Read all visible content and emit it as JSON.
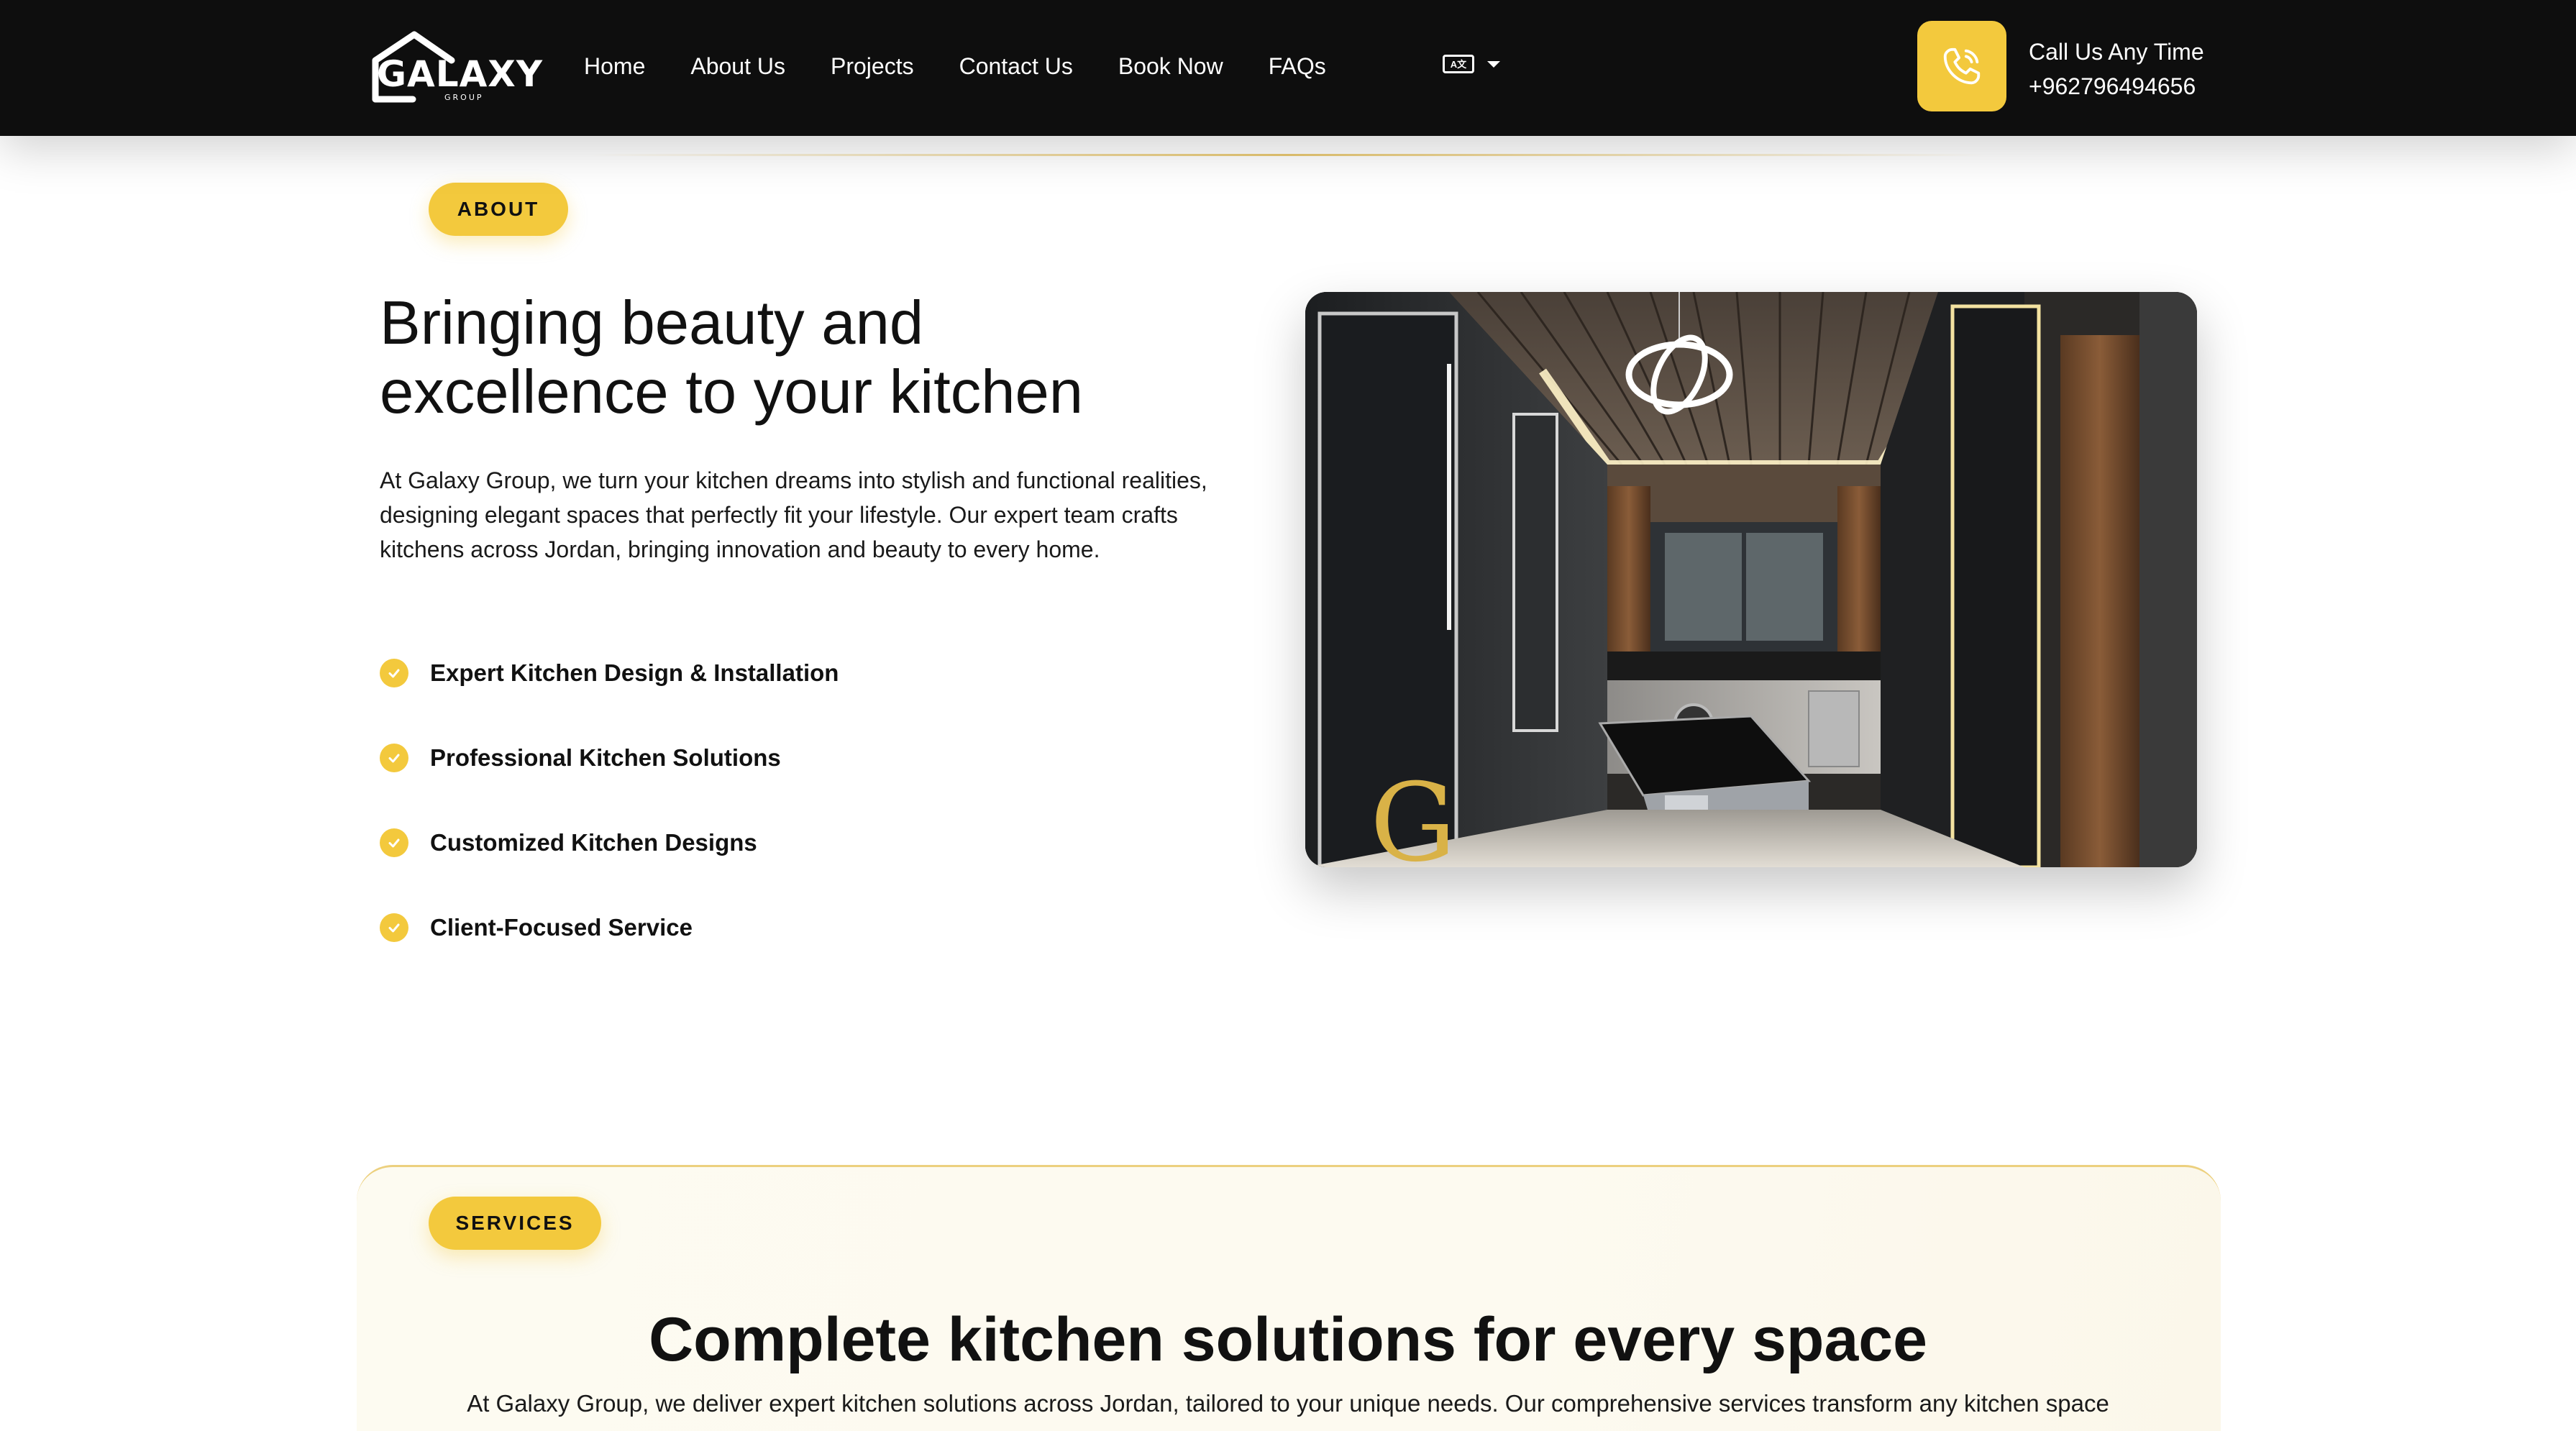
{
  "brand": {
    "logo_text": "GALAXY",
    "logo_sub": "GROUP",
    "accent_color": "#f3c93d",
    "nav_bg_color": "#0e0e0e"
  },
  "nav": {
    "links": [
      {
        "label": "Home"
      },
      {
        "label": "About Us"
      },
      {
        "label": "Projects"
      },
      {
        "label": "Contact Us"
      },
      {
        "label": "Book Now"
      },
      {
        "label": "FAQs"
      }
    ],
    "language_icon": "translate-icon",
    "call": {
      "icon": "phone-icon",
      "label": "Call Us Any Time",
      "phone": "+962796494656"
    }
  },
  "about": {
    "badge": "ABOUT",
    "heading_line1": "Bringing beauty and",
    "heading_line2": "excellence to your kitchen",
    "description": "At Galaxy Group, we turn your kitchen dreams into stylish and functional realities, designing elegant spaces that perfectly fit your lifestyle. Our expert team crafts kitchens across Jordan, bringing innovation and beauty to every home.",
    "features": [
      {
        "label": "Expert Kitchen Design & Installation",
        "icon": "check-circle-icon"
      },
      {
        "label": "Professional Kitchen Solutions",
        "icon": "check-circle-icon"
      },
      {
        "label": "Customized Kitchen Designs",
        "icon": "check-circle-icon"
      },
      {
        "label": "Client-Focused Service",
        "icon": "check-circle-icon"
      }
    ],
    "image": {
      "watermark_letter": "G"
    }
  },
  "services": {
    "badge": "SERVICES",
    "heading": "Complete kitchen solutions for every space",
    "description": "At Galaxy Group, we deliver expert kitchen solutions across Jordan, tailored to your unique needs. Our comprehensive services transform any kitchen space"
  }
}
